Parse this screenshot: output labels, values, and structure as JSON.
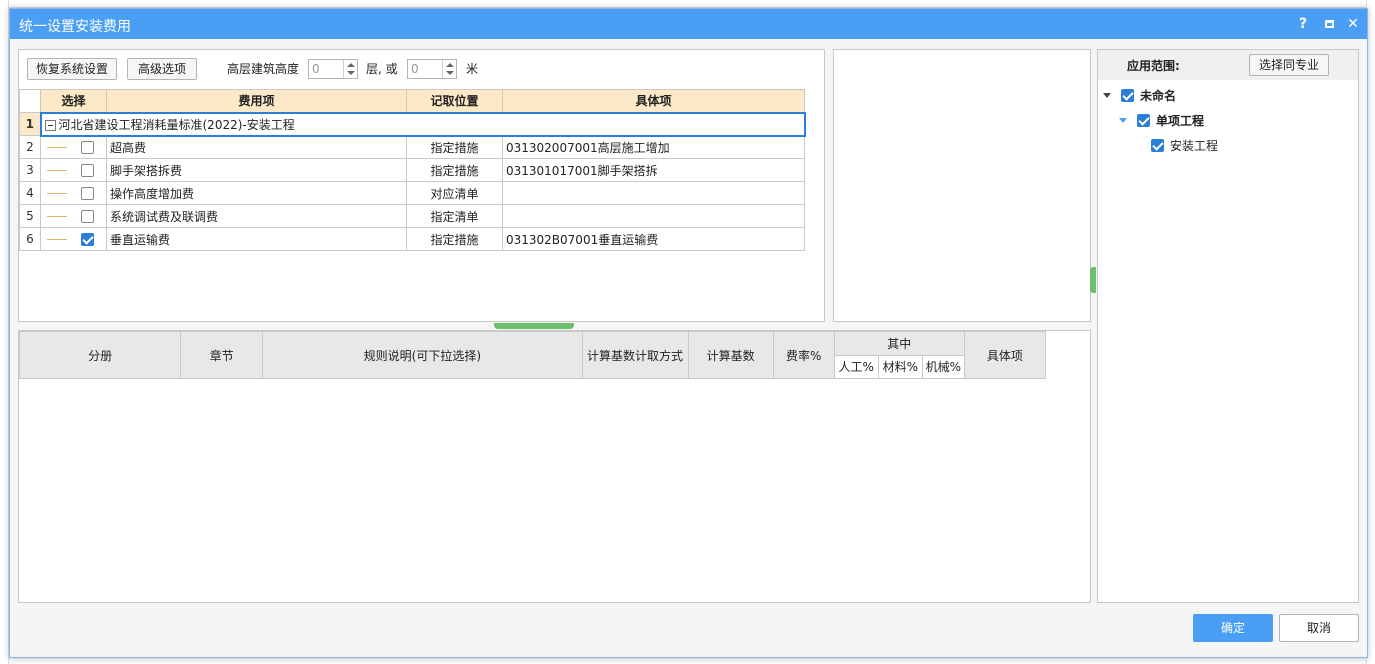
{
  "dialog": {
    "title": "统一设置安装费用",
    "help_label": "?",
    "close_label": "✕"
  },
  "toolbar": {
    "restore_label": "恢复系统设置",
    "advanced_label": "高级选项",
    "height_label": "高层建筑高度",
    "floors_value": "0",
    "floors_unit": "层, 或",
    "meters_value": "0",
    "meters_unit": "米"
  },
  "fee_table": {
    "headers": [
      "选择",
      "费用项",
      "记取位置",
      "具体项"
    ],
    "group_row": {
      "num": "1",
      "label": "河北省建设工程消耗量标准(2022)-安装工程"
    },
    "rows": [
      {
        "num": "2",
        "checked": false,
        "name": "超高费",
        "position": "指定措施",
        "detail": "031302007001高层施工增加"
      },
      {
        "num": "3",
        "checked": false,
        "name": "脚手架搭拆费",
        "position": "指定措施",
        "detail": "031301017001脚手架搭拆"
      },
      {
        "num": "4",
        "checked": false,
        "name": "操作高度增加费",
        "position": "对应清单",
        "detail": ""
      },
      {
        "num": "5",
        "checked": false,
        "name": "系统调试费及联调费",
        "position": "指定清单",
        "detail": ""
      },
      {
        "num": "6",
        "checked": true,
        "name": "垂直运输费",
        "position": "指定措施",
        "detail": "031302B07001垂直运输费"
      }
    ]
  },
  "rules_table": {
    "headers": {
      "volume": "分册",
      "chapter": "章节",
      "rule": "规则说明(可下拉选择)",
      "calc_method": "计算基数计取方式",
      "calc_base": "计算基数",
      "rate": "费率%",
      "among": "其中",
      "labor": "人工%",
      "material": "材料%",
      "machine": "机械%",
      "detail": "具体项"
    }
  },
  "scope": {
    "label": "应用范围:",
    "same_specialty_label": "选择同专业",
    "tree": [
      {
        "label": "未命名",
        "checked": true,
        "bold": true
      },
      {
        "label": "单项工程",
        "checked": true,
        "bold": true
      },
      {
        "label": "安装工程",
        "checked": true,
        "bold": false
      }
    ]
  },
  "footer": {
    "ok_label": "确定",
    "cancel_label": "取消"
  },
  "colors": {
    "titlebar": "#4a9ff5",
    "header_bg": "#fde9c7",
    "primary_button": "#4a9ff5"
  }
}
